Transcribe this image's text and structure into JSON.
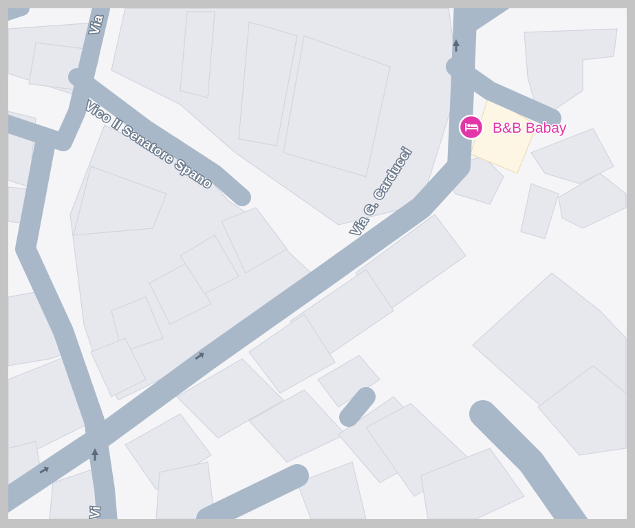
{
  "streets": {
    "vico_senatore_spano": "Vico II Senatore Spano",
    "via_carducci": "Via G. Carducci",
    "via_top_left": "Via",
    "via_bottom": "Vi"
  },
  "poi": {
    "name": "B&B Babay",
    "icon": "bed-icon",
    "color": "#e236a8"
  },
  "colors": {
    "road": "#a9b8c9",
    "building": "#e7e8ee",
    "background": "#f5f5f7",
    "poi_area": "#fdf6e4"
  }
}
